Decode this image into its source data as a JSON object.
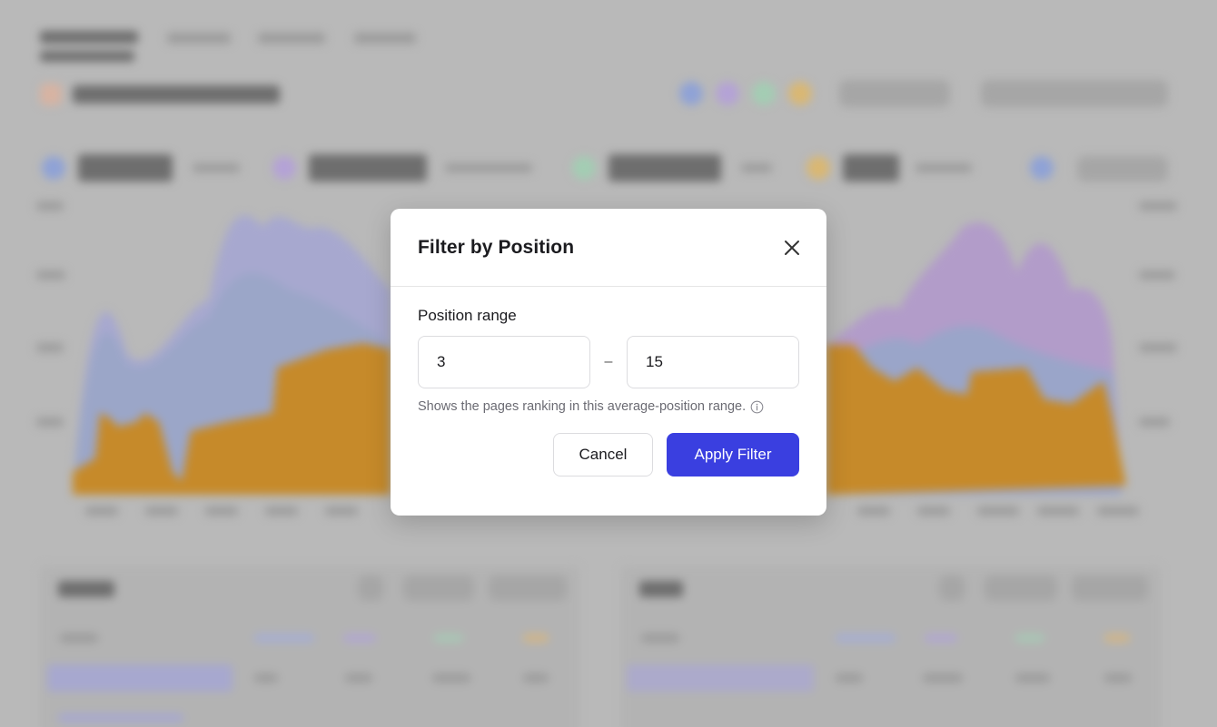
{
  "modal": {
    "title": "Filter by Position",
    "field_label": "Position range",
    "min_value": "3",
    "max_value": "15",
    "separator": "–",
    "help_text": "Shows the pages ranking in this average-position range.",
    "cancel_label": "Cancel",
    "apply_label": "Apply Filter"
  },
  "colors": {
    "primary": "#3a3fe0",
    "clicks": "#e0962e",
    "impressions": "#b79ad6",
    "ctr": "#8fd1b0",
    "position": "#93a8dd"
  }
}
